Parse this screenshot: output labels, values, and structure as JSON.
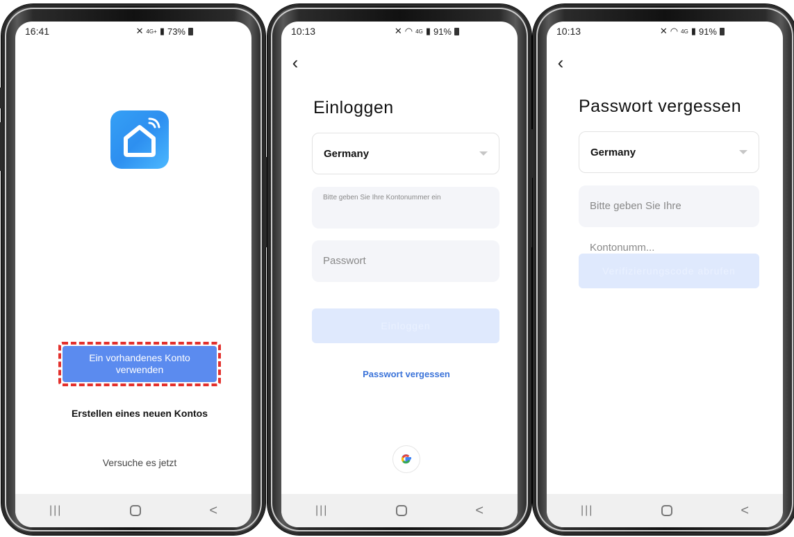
{
  "phone1": {
    "status": {
      "time": "16:41",
      "signal": "4G+",
      "battery": "73%"
    },
    "primary_button": "Ein vorhandenes Konto verwenden",
    "secondary_button": "Erstellen eines neuen Kontos",
    "try_link": "Versuche es jetzt",
    "highlight_color": "#e3302c",
    "accent": "#5b8bef"
  },
  "phone2": {
    "status": {
      "time": "10:13",
      "signal": "4G",
      "battery": "91%"
    },
    "heading": "Einloggen",
    "country": "Germany",
    "account_placeholder": "Bitte geben Sie Ihre Kontonummer ein",
    "password_placeholder": "Passwort",
    "login_button": "Einloggen",
    "forgot_link": "Passwort vergessen"
  },
  "phone3": {
    "status": {
      "time": "10:13",
      "signal": "4G",
      "battery": "91%"
    },
    "heading": "Passwort vergessen",
    "country": "Germany",
    "account_placeholder": "Bitte geben Sie Ihre Kontonumm...",
    "verify_button": "Verifizierungscode abrufen"
  },
  "icons": {
    "back": "chevron-left-icon",
    "dropdown": "caret-down-icon",
    "google": "google-icon",
    "app": "smart-home-icon"
  },
  "nav": {
    "recents": "|||",
    "back": "<"
  }
}
